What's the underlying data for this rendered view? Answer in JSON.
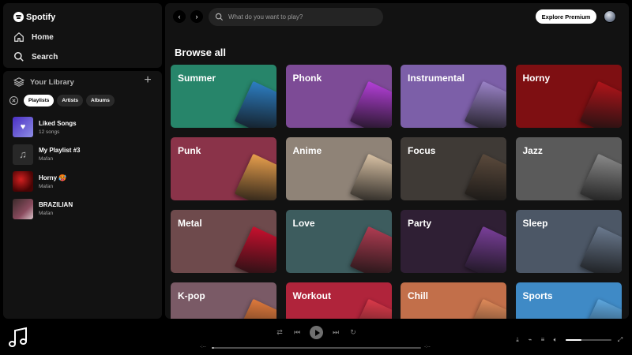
{
  "brand": {
    "name": "Spotify"
  },
  "nav": {
    "home_label": "Home",
    "search_label": "Search"
  },
  "library": {
    "title": "Your Library",
    "filters": [
      "Playlists",
      "Artists",
      "Albums"
    ],
    "active_filter": "Playlists",
    "items": [
      {
        "title": "Liked Songs",
        "subtitle": "12 songs"
      },
      {
        "title": "My Playlist #3",
        "subtitle": "Mafan"
      },
      {
        "title": "Horny 🥵",
        "subtitle": "Mafan"
      },
      {
        "title": "BRAZILIAN",
        "subtitle": "Mafan"
      }
    ]
  },
  "topbar": {
    "search_placeholder": "What do you want to play?",
    "premium_label": "Explore Premium"
  },
  "browse": {
    "title": "Browse all",
    "categories": [
      {
        "label": "Summer",
        "color": "#27856a",
        "art": "#2d7fc4"
      },
      {
        "label": "Phonk",
        "color": "#7d4b96",
        "art": "#b43fd8"
      },
      {
        "label": "Instrumental",
        "color": "#7c5fa8",
        "art": "#9b83c8"
      },
      {
        "label": "Horny",
        "color": "#7e0f12",
        "art": "#b0141a"
      },
      {
        "label": "Punk",
        "color": "#8a3349",
        "art": "#e9a04d"
      },
      {
        "label": "Anime",
        "color": "#8f8377",
        "art": "#d9c2a5"
      },
      {
        "label": "Focus",
        "color": "#3f3a36",
        "art": "#5b4a3c"
      },
      {
        "label": "Jazz",
        "color": "#5a5a5a",
        "art": "#8a8a8a"
      },
      {
        "label": "Metal",
        "color": "#6e4a4c",
        "art": "#c8102e"
      },
      {
        "label": "Love",
        "color": "#3d5c5e",
        "art": "#b03c52"
      },
      {
        "label": "Party",
        "color": "#2f1f34",
        "art": "#7a3f9a"
      },
      {
        "label": "Sleep",
        "color": "#4c5766",
        "art": "#6b7a8f"
      },
      {
        "label": "K-pop",
        "color": "#7a5a66",
        "art": "#e07a3c"
      },
      {
        "label": "Workout",
        "color": "#b0243b",
        "art": "#dc3a4a"
      },
      {
        "label": "Chill",
        "color": "#c26f4a",
        "art": "#e08b5a"
      },
      {
        "label": "Sports",
        "color": "#3f8ac6",
        "art": "#5ea8e0"
      }
    ]
  },
  "player": {
    "time_elapsed": "-:--",
    "time_total": "-:--",
    "progress_percent": 1,
    "volume_percent": 35
  }
}
